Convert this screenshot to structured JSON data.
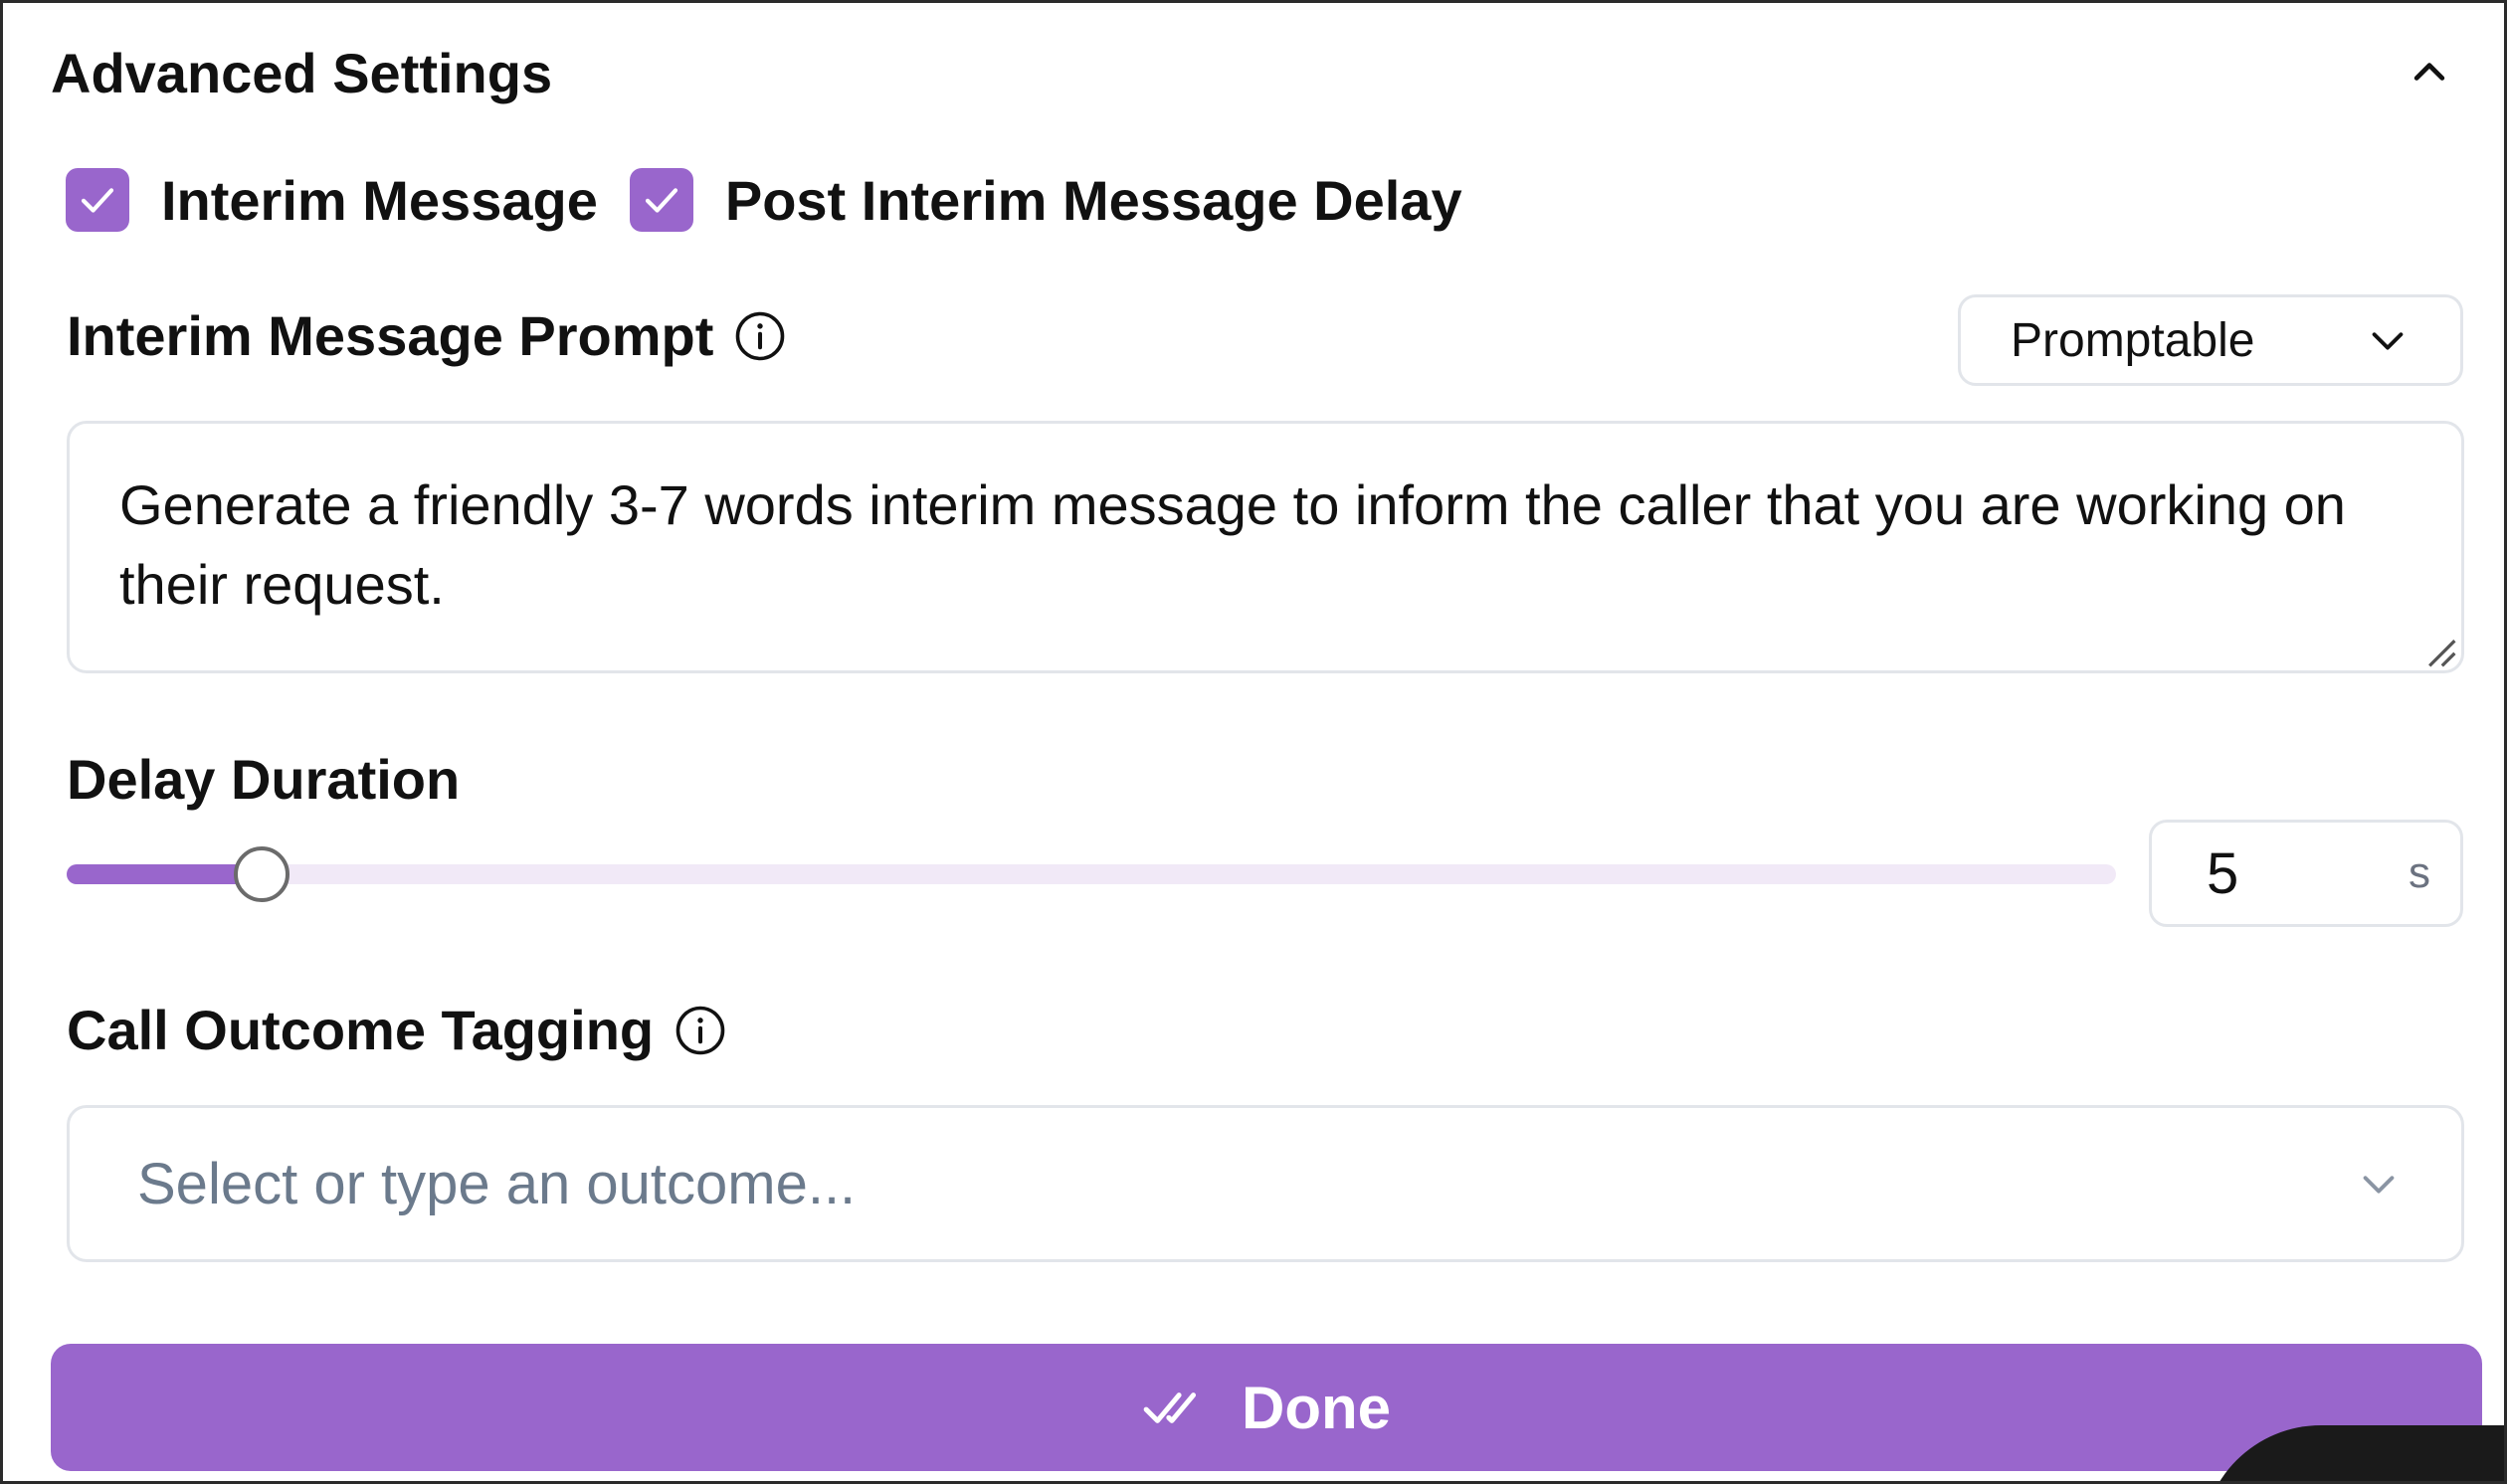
{
  "header": {
    "title": "Advanced Settings",
    "collapse_icon": "chevron-up-icon"
  },
  "options": [
    {
      "label": "Interim Message",
      "checked": true
    },
    {
      "label": "Post Interim Message Delay",
      "checked": true
    }
  ],
  "prompt": {
    "label": "Interim Message Prompt",
    "info_icon": "info-icon",
    "mode": "Promptable",
    "text": "Generate a friendly 3-7 words interim message to inform the caller that you are working on their request."
  },
  "delay": {
    "label": "Delay Duration",
    "value": "5",
    "unit": "s",
    "slider_fraction": 0.095
  },
  "outcome": {
    "label": "Call Outcome Tagging",
    "info_icon": "info-icon",
    "placeholder": "Select or type an outcome..."
  },
  "done_button": {
    "label": "Done",
    "icon": "double-check-icon"
  },
  "colors": {
    "accent": "#9966cc",
    "slider_track": "#f1e9f7",
    "border": "#e2e5ea",
    "placeholder": "#6b7a8c"
  }
}
